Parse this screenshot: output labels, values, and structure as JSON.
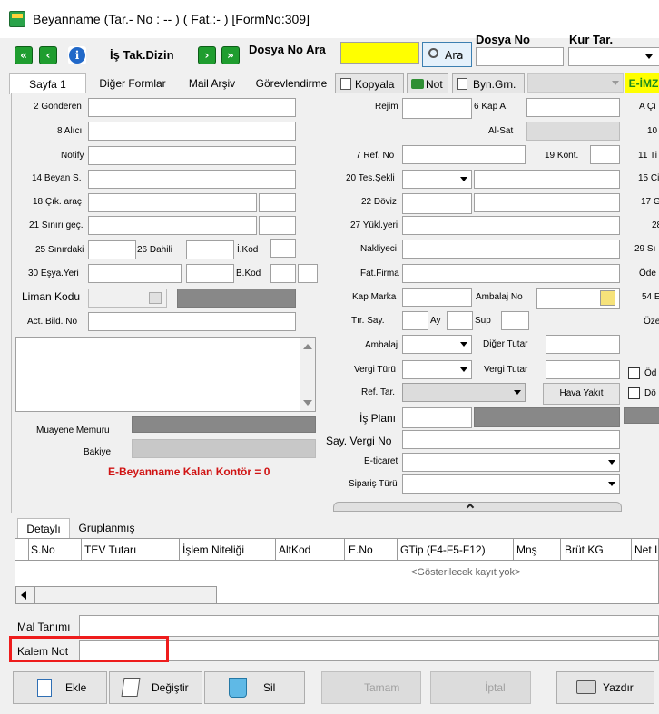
{
  "window": {
    "title": "Beyanname (Tar.- No : --  ) ( Fat.:- )  [FormNo:309]"
  },
  "toolbar": {
    "first": "«",
    "prev": "‹",
    "info": "i",
    "is_takip": "İş Tak.Dizin",
    "next": "›",
    "last": "»",
    "dosya_no_ara": "Dosya No Ara",
    "ara_button": "Ara",
    "dosya_no": "Dosya No",
    "kur_tar": "Kur Tar."
  },
  "tabs": [
    "Sayfa 1",
    "Diğer Formlar",
    "Mail Arşiv",
    "Görevlendirme",
    "Kopyala",
    "Not",
    "Byn.Grn.",
    "E-İMZ"
  ],
  "left_fields": {
    "gonderen": "2 Gönderen",
    "alici": "8 Alıcı",
    "notify": "Notify",
    "beyan_s": "14 Beyan S.",
    "cik_arac": "18 Çık. araç",
    "sinir_gec": "21 Sınırı geç.",
    "sinirdaki": "25 Sınırdaki",
    "dahili": "26 Dahili",
    "i_kod": "İ.Kod",
    "esya_yeri": "30 Eşya.Yeri",
    "b_kod": "B.Kod",
    "liman_kodu": "Liman Kodu",
    "act_bild": "Act. Bild. No",
    "muayene": "Muayene Memuru",
    "bakiye": "Bakiye",
    "kontor": "E-Beyanname Kalan Kontör = 0"
  },
  "mid_fields": {
    "rejim": "Rejim",
    "kap_a": "6 Kap A.",
    "al_sat": "Al-Sat",
    "ref_no": "7 Ref. No",
    "kont": "19.Kont.",
    "tes_sekli": "20 Tes.Şekli",
    "doviz": "22 Döviz",
    "yukl_yeri": "27 Yükl.yeri",
    "nakliyeci": "Nakliyeci",
    "fat_firma": "Fat.Firma",
    "kap_marka": "Kap Marka",
    "ambalaj_no": "Ambalaj No",
    "tir_say": "Tır. Say.",
    "ay": "Ay",
    "sup": "Sup",
    "ambalaj": "Ambalaj",
    "diger_tutar": "Diğer Tutar",
    "vergi_turu": "Vergi Türü",
    "vergi_tutar": "Vergi Tutar",
    "ref_tar": "Ref. Tar.",
    "hava_yakit": "Hava Yakıt",
    "is_plani": "İş Planı",
    "say_vergi_no": "Say. Vergi No",
    "e_ticaret": "E-ticaret",
    "siparis_turu": "Sipariş Türü"
  },
  "right_fields": [
    "A Çı",
    "10",
    "11 Ti",
    "15 Ci",
    "17 G",
    "28",
    "29 Sı",
    "Öde",
    "54 E",
    "Öze",
    "Öd",
    "Dö"
  ],
  "grid": {
    "tabs": [
      "Detaylı",
      "Gruplanmış"
    ],
    "columns": [
      "S.No",
      "TEV Tutarı",
      "İşlem Niteliği",
      "AltKod",
      "E.No",
      "GTip (F4-F5-F12)",
      "Mnş",
      "Brüt KG",
      "Net I"
    ],
    "empty": "<Gösterilecek kayıt yok>"
  },
  "bottom": {
    "mal_tanimi": "Mal Tanımı",
    "kalem_not": "Kalem Not"
  },
  "buttons": {
    "ekle": "Ekle",
    "degistir": "Değiştir",
    "sil": "Sil",
    "tamam": "Tamam",
    "iptal": "İptal",
    "yazdir": "Yazdır"
  },
  "colors": {
    "highlight": "#ffff00",
    "red_box": "#ee1c1c",
    "green_nav": "#1f9d2f",
    "kontor_red": "#d01414"
  }
}
